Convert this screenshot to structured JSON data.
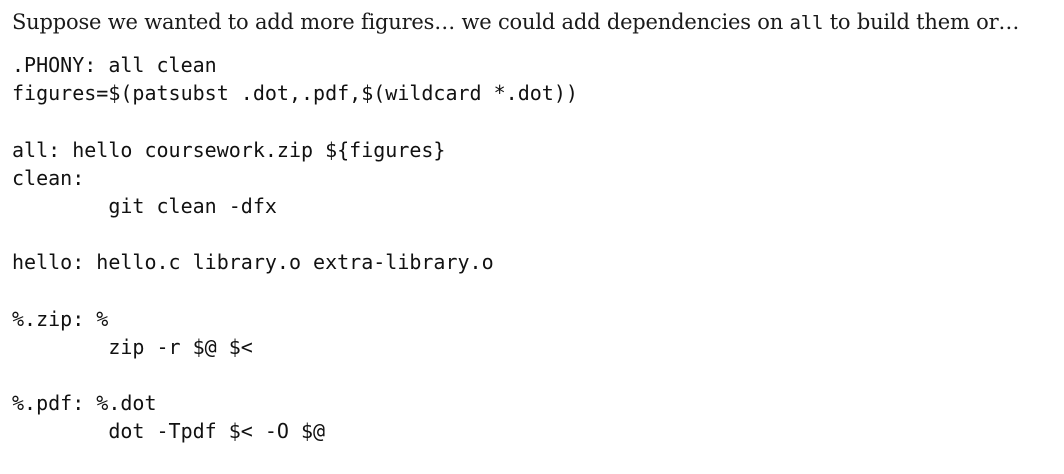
{
  "intro": {
    "text_before": "Suppose we wanted to add more figures… we could add dependencies on ",
    "code": "all",
    "text_after": " to build them or…"
  },
  "code_lines": [
    ".PHONY: all clean",
    "figures=$(patsubst .dot,.pdf,$(wildcard *.dot))",
    "",
    "all: hello coursework.zip ${figures}",
    "clean:",
    "        git clean -dfx",
    "",
    "hello: hello.c library.o extra-library.o",
    "",
    "%.zip: %",
    "        zip -r $@ $<",
    "",
    "%.pdf: %.dot",
    "        dot -Tpdf $< -O $@"
  ]
}
